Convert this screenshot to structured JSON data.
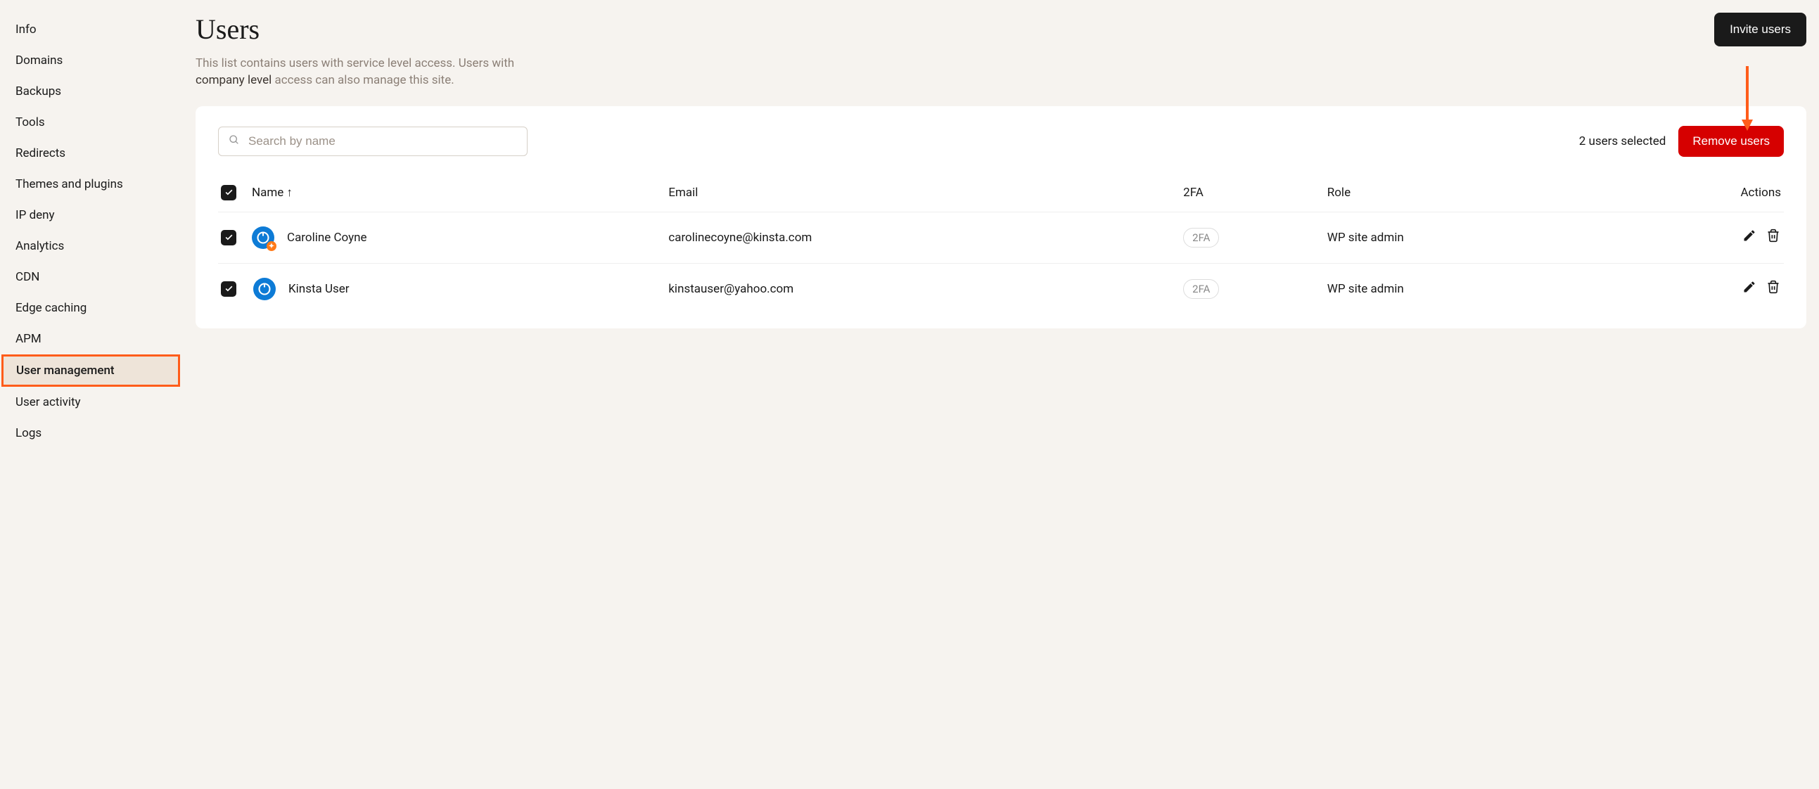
{
  "sidebar": {
    "items": [
      {
        "label": "Info"
      },
      {
        "label": "Domains"
      },
      {
        "label": "Backups"
      },
      {
        "label": "Tools"
      },
      {
        "label": "Redirects"
      },
      {
        "label": "Themes and plugins"
      },
      {
        "label": "IP deny"
      },
      {
        "label": "Analytics"
      },
      {
        "label": "CDN"
      },
      {
        "label": "Edge caching"
      },
      {
        "label": "APM"
      },
      {
        "label": "User management",
        "active": true
      },
      {
        "label": "User activity"
      },
      {
        "label": "Logs"
      }
    ]
  },
  "page": {
    "title": "Users",
    "desc_prefix": "This list contains users with service level access. Users with ",
    "desc_strong": "company level",
    "desc_suffix": " access can also manage this site.",
    "invite_label": "Invite users"
  },
  "toolbar": {
    "search_placeholder": "Search by name",
    "selected_text": "2 users selected",
    "remove_label": "Remove users"
  },
  "table": {
    "headers": {
      "name": "Name",
      "email": "Email",
      "twofa": "2FA",
      "role": "Role",
      "actions": "Actions"
    },
    "rows": [
      {
        "checked": true,
        "name": "Caroline Coyne",
        "email": "carolinecoyne@kinsta.com",
        "twofa": "2FA",
        "role": "WP site admin",
        "badge": true
      },
      {
        "checked": true,
        "name": "Kinsta User",
        "email": "kinstauser@yahoo.com",
        "twofa": "2FA",
        "role": "WP site admin",
        "badge": false
      }
    ]
  }
}
